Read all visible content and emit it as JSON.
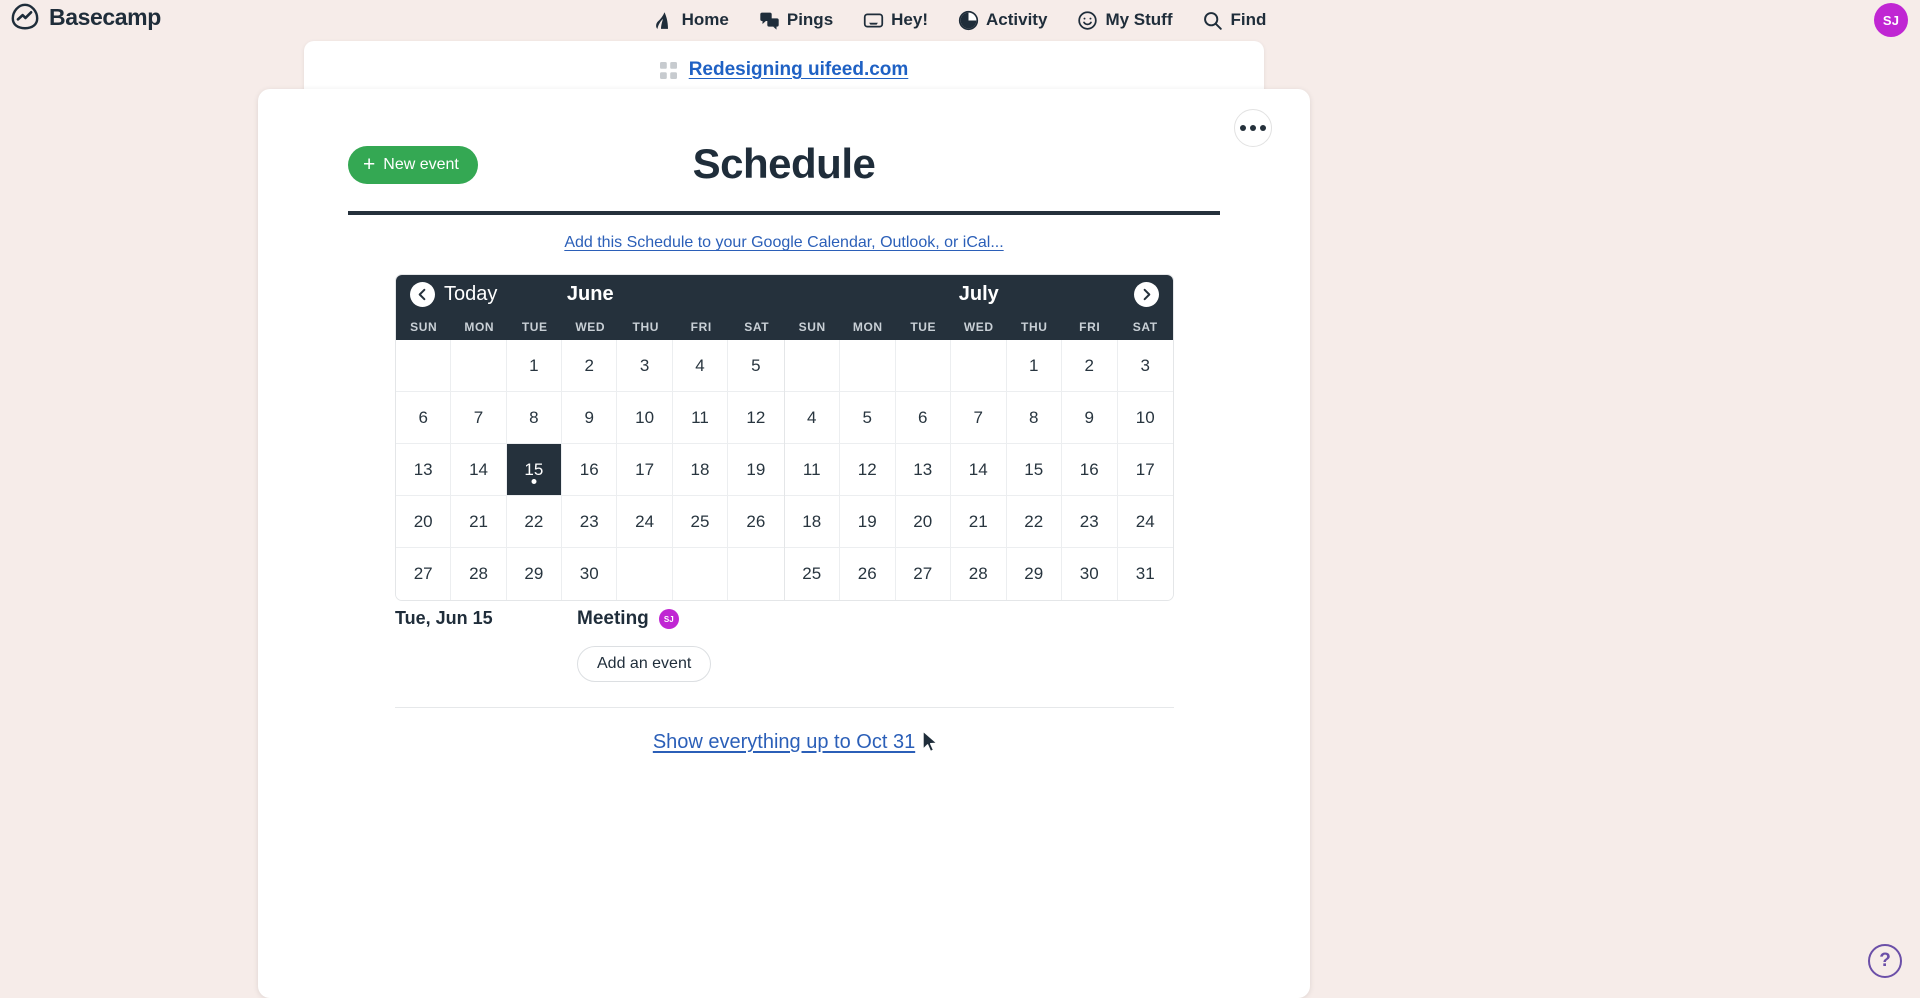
{
  "brand": {
    "name": "Basecamp",
    "logo_icon": "basecamp-logo-icon"
  },
  "nav": {
    "items": [
      {
        "label": "Home",
        "icon": "home-icon"
      },
      {
        "label": "Pings",
        "icon": "chat-bubbles-icon"
      },
      {
        "label": "Hey!",
        "icon": "inbox-tray-icon"
      },
      {
        "label": "Activity",
        "icon": "pie-clock-icon"
      },
      {
        "label": "My Stuff",
        "icon": "smiley-face-icon"
      },
      {
        "label": "Find",
        "icon": "search-icon"
      }
    ],
    "avatar_initials": "SJ",
    "avatar_color": "#c026d3"
  },
  "breadcrumb": {
    "icon": "grid-squares-icon",
    "project_name": "Redesigning uifeed.com"
  },
  "toolbar": {
    "more_icon": "ellipsis-icon",
    "new_event_label": "New event",
    "new_event_icon": "plus-icon",
    "new_event_color": "#34a853"
  },
  "header": {
    "title": "Schedule",
    "subscribe_link": "Add this Schedule to your Google Calendar, Outlook, or iCal..."
  },
  "calendar": {
    "today_label": "Today",
    "prev_icon": "chevron-left-icon",
    "next_icon": "chevron-right-icon",
    "weekday_labels": [
      "SUN",
      "MON",
      "TUE",
      "WED",
      "THU",
      "FRI",
      "SAT"
    ],
    "header_color": "#25313c",
    "months": [
      {
        "name": "June",
        "lead_blanks": 2,
        "days": [
          1,
          2,
          3,
          4,
          5,
          6,
          7,
          8,
          9,
          10,
          11,
          12,
          13,
          14,
          15,
          16,
          17,
          18,
          19,
          20,
          21,
          22,
          23,
          24,
          25,
          26,
          27,
          28,
          29,
          30
        ],
        "today": 15,
        "days_with_events": [
          15
        ]
      },
      {
        "name": "July",
        "lead_blanks": 4,
        "days": [
          1,
          2,
          3,
          4,
          5,
          6,
          7,
          8,
          9,
          10,
          11,
          12,
          13,
          14,
          15,
          16,
          17,
          18,
          19,
          20,
          21,
          22,
          23,
          24,
          25,
          26,
          27,
          28,
          29,
          30,
          31
        ],
        "today": null,
        "days_with_events": []
      }
    ]
  },
  "events": {
    "rows": [
      {
        "date": "Tue, Jun 15",
        "title": "Meeting",
        "attendee_initials": "SJ"
      }
    ],
    "add_event_label": "Add an event"
  },
  "footer": {
    "show_everything_link": "Show everything up to Oct 31"
  },
  "help": {
    "label": "?",
    "icon": "question-mark-icon"
  }
}
